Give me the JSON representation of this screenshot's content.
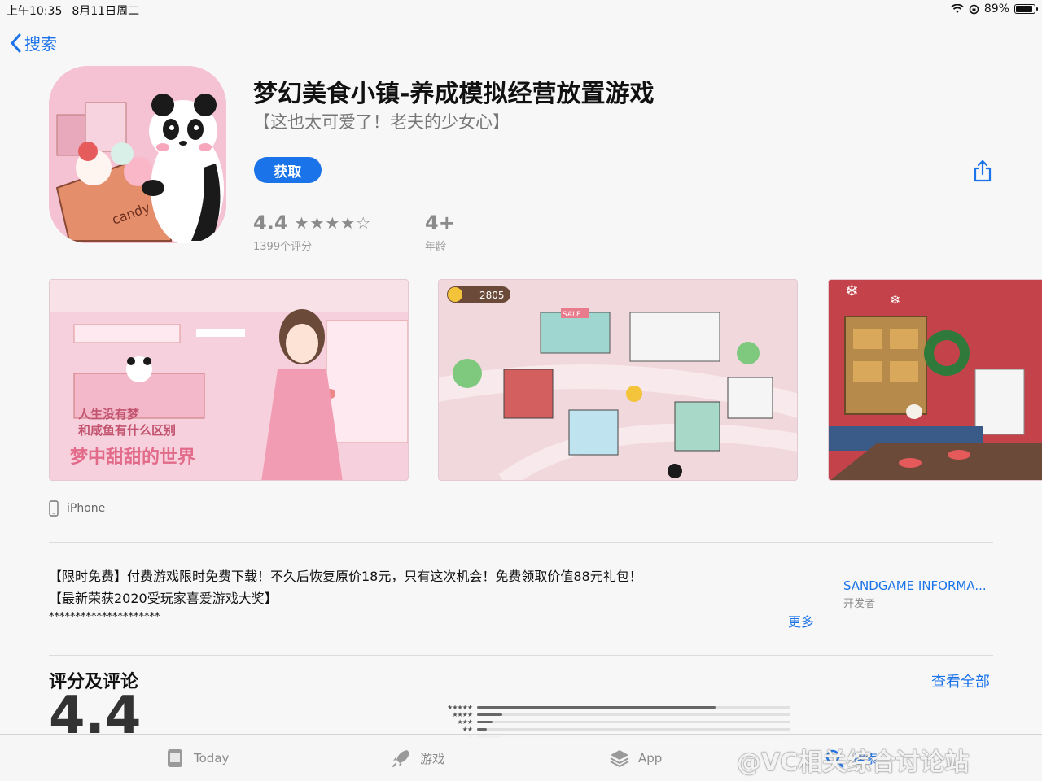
{
  "status_bar": {
    "time": "上午10:35",
    "date": "8月11日周二",
    "battery": "89%",
    "battery_level": 0.89
  },
  "nav": {
    "back_label": "搜索"
  },
  "app": {
    "title": "梦幻美食小镇-养成模拟经营放置游戏",
    "subtitle": "【这也太可爱了！老夫的少女心】",
    "get_label": "获取",
    "rating": "4.4",
    "stars_display": "★★★★☆",
    "rating_count": "1399个评分",
    "age": "4+",
    "age_label": "年龄",
    "icon_text": "candy"
  },
  "screenshots": {
    "shot1_caption_1": "人生没有梦",
    "shot1_caption_2": "和咸鱼有什么区别",
    "shot1_caption_3": "梦中甜甜的世界",
    "shot2_coins": "2805",
    "shot2_sign": "SALE"
  },
  "device": {
    "label": "iPhone"
  },
  "description": {
    "line1": "【限时免费】付费游戏限时免费下载！不久后恢复原价18元，只有这次机会！免费领取价值88元礼包！",
    "line2": "【最新荣获2020受玩家喜爱游戏大奖】",
    "line3": "*********************",
    "more_label": "更多"
  },
  "developer": {
    "name": "SANDGAME INFORMA...",
    "label": "开发者"
  },
  "ratings_section": {
    "title": "评分及评论",
    "see_all": "查看全部",
    "big_score": "4.4",
    "histogram": [
      {
        "stars": "★★★★★",
        "fraction": 0.76
      },
      {
        "stars": "★★★★",
        "fraction": 0.08
      },
      {
        "stars": "★★★",
        "fraction": 0.05
      },
      {
        "stars": "★★",
        "fraction": 0.03
      },
      {
        "stars": "★",
        "fraction": 0.08
      }
    ]
  },
  "tabbar": {
    "today": "Today",
    "games": "游戏",
    "apps": "App",
    "search": "搜索"
  },
  "watermark": "@VC相关综合讨论站",
  "colors": {
    "accent": "#1a73e8",
    "background": "#f7f7f7"
  }
}
